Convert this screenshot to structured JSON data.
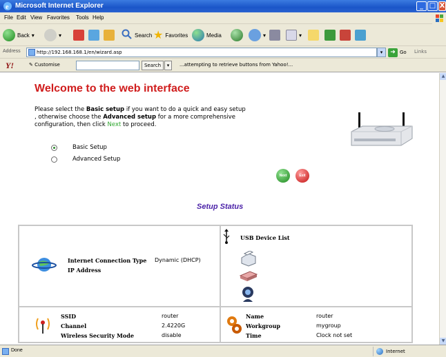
{
  "window": {
    "title": "Microsoft Internet Explorer",
    "min_label": "_",
    "max_label": "□",
    "close_label": "X"
  },
  "menu": [
    "File",
    "Edit",
    "View",
    "Favorites",
    "Tools",
    "Help"
  ],
  "toolbar": {
    "back_label": "Back",
    "search_label": "Search",
    "favorites_label": "Favorites",
    "media_label": "Media"
  },
  "address": {
    "label": "Address",
    "url": "http://192.168.168.1/en/wizard.asp",
    "go_label": "Go",
    "links_label": "Links"
  },
  "yahoo": {
    "logo": "Y!",
    "customise_label": "Customise",
    "search_label": "Search",
    "status_message": "...attempting to retrieve buttons from Yahoo!..."
  },
  "page": {
    "heading": "Welcome to the web interface",
    "intro_1": "Please select the ",
    "intro_basic": "Basic setup",
    "intro_2": " if you want to do a quick and easy setup",
    "intro_3": " , otherwise choose the ",
    "intro_advanced": "Advanced setup",
    "intro_4": " for a more comprehensive",
    "intro_5": "configuration, then click ",
    "intro_next": "Next",
    "intro_6": " to proceed.",
    "options": [
      {
        "label": "Basic Setup",
        "selected": true
      },
      {
        "label": "Advanced Setup",
        "selected": false
      }
    ],
    "next_label": "Next",
    "exit_label": "Exit",
    "setup_status_title": "Setup Status"
  },
  "status": {
    "internet_type_label": "Internet Connection Type",
    "internet_type_value": "Dynamic (DHCP)",
    "ip_label": "IP Address",
    "ip_value": "",
    "usb_title": "USB Device List",
    "ssid_label": "SSID",
    "ssid_value": "router",
    "channel_label": "Channel",
    "channel_value": "2.4220G",
    "security_label": "Wireless Security Mode",
    "security_value": "disable",
    "name_label": "Name",
    "name_value": "router",
    "workgroup_label": "Workgroup",
    "workgroup_value": "mygroup",
    "time_label": "Time",
    "time_value": "Clock not set"
  },
  "statusbar": {
    "done": "Done",
    "zone": "Internet"
  }
}
